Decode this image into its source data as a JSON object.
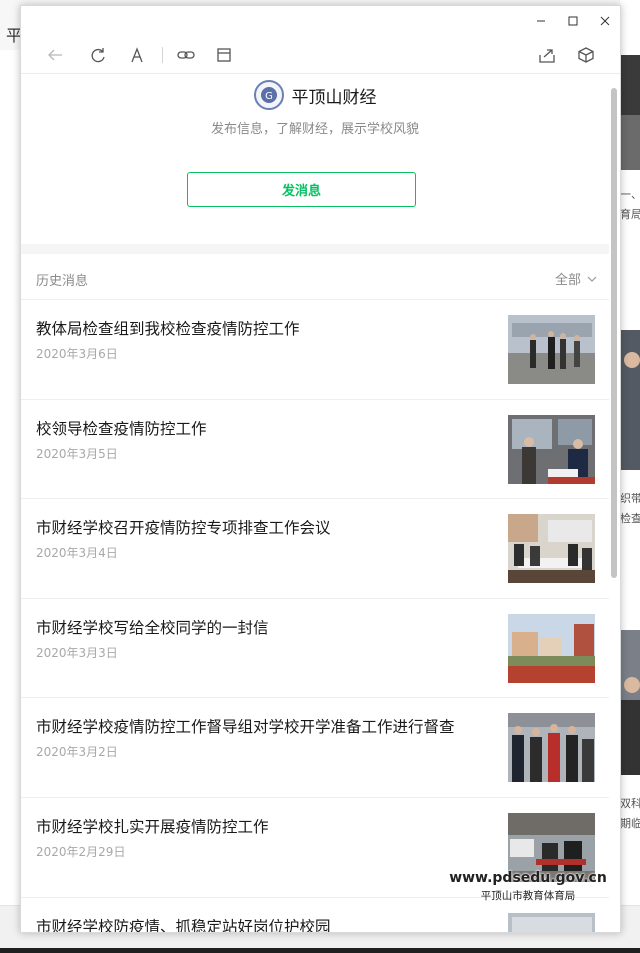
{
  "background": {
    "left_glyph": "平",
    "right_snippets": [
      "一、",
      "育局",
      "织带领",
      "检查",
      "双科表",
      "期临市"
    ]
  },
  "window": {
    "controls": {
      "minimize": "–",
      "maximize": "□",
      "close": "✕"
    }
  },
  "account": {
    "name": "平顶山财经",
    "description": "发布信息，了解财经，展示学校风貌",
    "send_button": "发消息"
  },
  "history": {
    "title": "历史消息",
    "filter_label": "全部",
    "articles": [
      {
        "title": "教体局检查组到我校检查疫情防控工作",
        "date": "2020年3月6日"
      },
      {
        "title": "校领导检查疫情防控工作",
        "date": "2020年3月5日"
      },
      {
        "title": "市财经学校召开疫情防控专项排查工作会议",
        "date": "2020年3月4日"
      },
      {
        "title": "市财经学校写给全校同学的一封信",
        "date": "2020年3月3日"
      },
      {
        "title": "市财经学校疫情防控工作督导组对学校开学准备工作进行督查",
        "date": "2020年3月2日"
      },
      {
        "title": "市财经学校扎实开展疫情防控工作",
        "date": "2020年2月29日"
      },
      {
        "title": "市财经学校防疫情、抓稳定站好岗位护校园",
        "date": ""
      }
    ]
  },
  "watermark": {
    "url": "www.pdsedu.gov.cn",
    "org": "平顶山市教育体育局"
  },
  "colors": {
    "accent": "#07c160",
    "muted": "#8a8a8a"
  }
}
